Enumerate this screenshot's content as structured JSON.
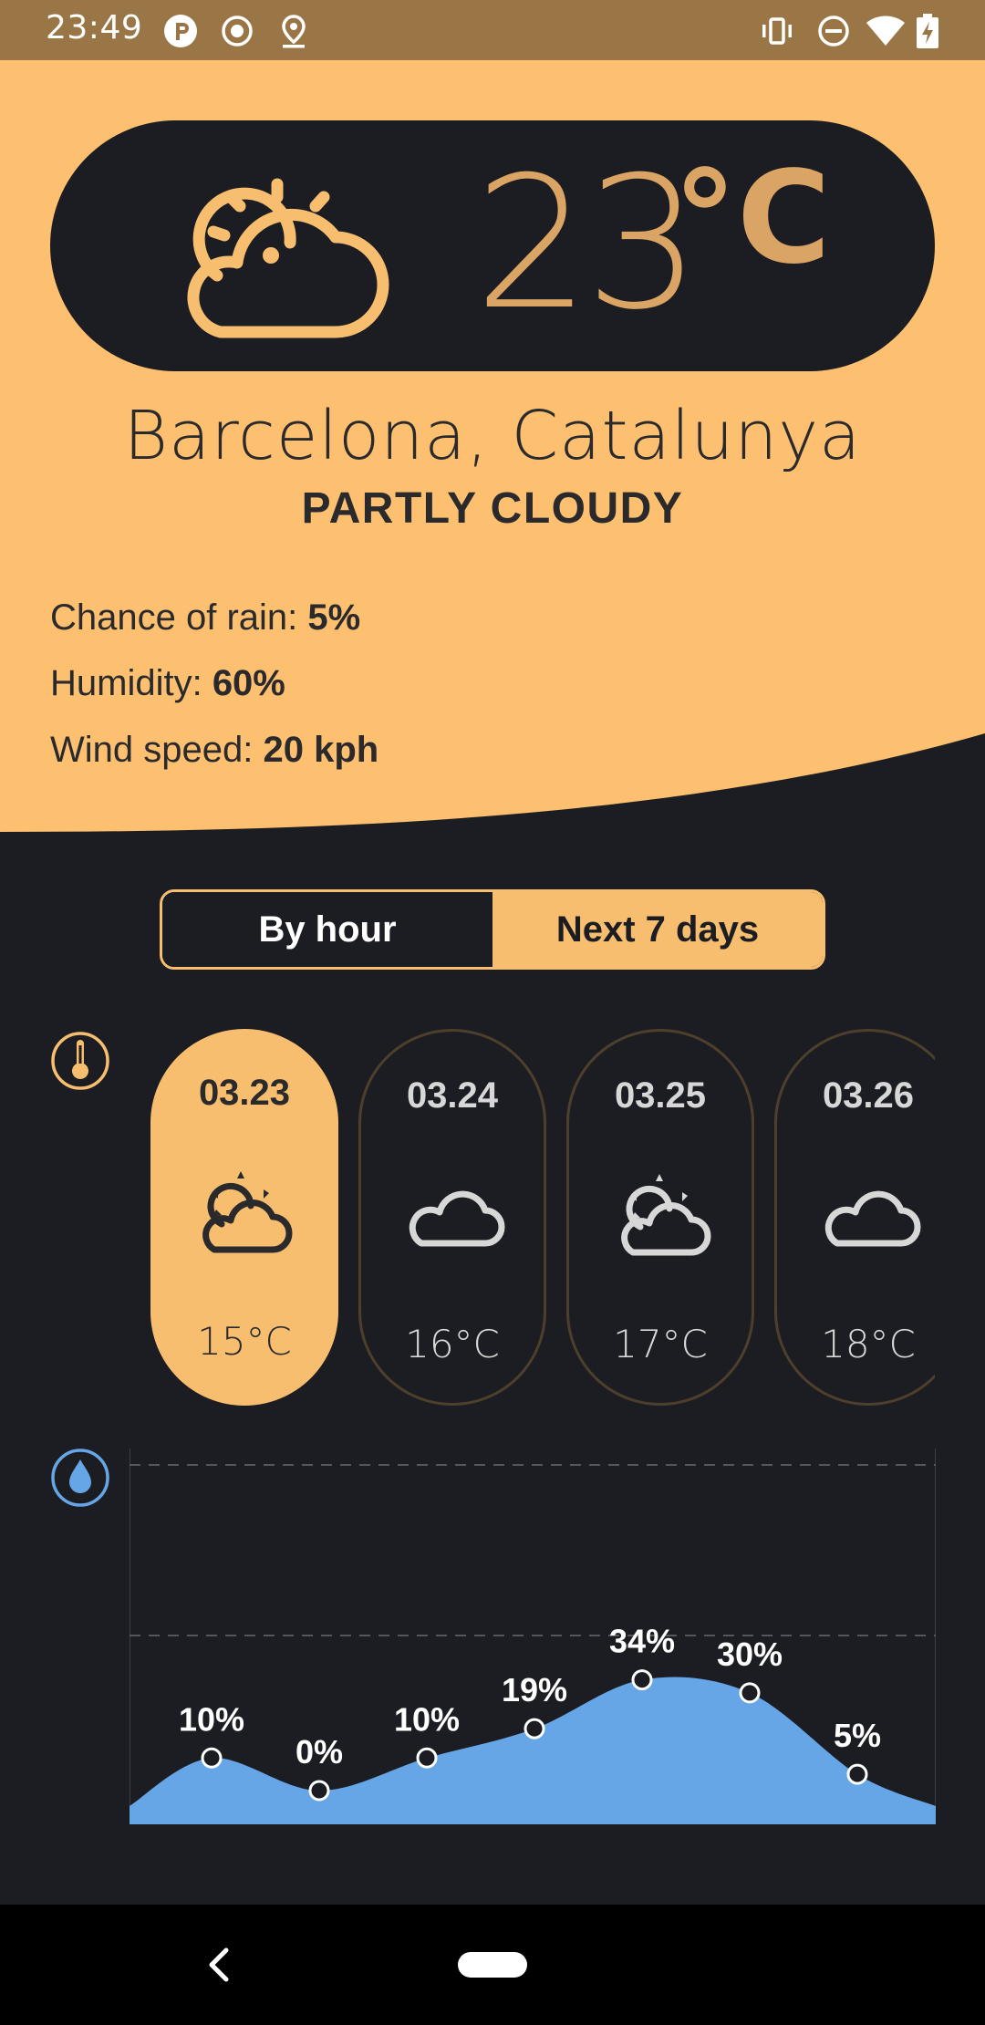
{
  "status_bar": {
    "time": "23:49",
    "left_icons": [
      "p-badge-icon",
      "screen-record-icon",
      "location-pin-icon"
    ],
    "right_icons": [
      "vibrate-icon",
      "do-not-disturb-icon",
      "wifi-icon",
      "battery-charging-icon"
    ]
  },
  "current": {
    "temperature": "23",
    "unit": "°C",
    "icon": "partly-cloudy-icon",
    "location": "Barcelona, Catalunya",
    "condition": "PARTLY CLOUDY",
    "details": [
      {
        "label": "Chance of rain: ",
        "value": "5%"
      },
      {
        "label": "Humidity: ",
        "value": "60%"
      },
      {
        "label": "Wind speed: ",
        "value": "20 kph"
      }
    ]
  },
  "toggle": {
    "by_hour": "By hour",
    "next_7_days": "Next 7 days"
  },
  "side_icons": [
    "thermometer-icon",
    "water-drop-icon"
  ],
  "days": [
    {
      "date": "03.23",
      "icon": "partly-cloudy-icon",
      "temp": "15°C",
      "selected": true
    },
    {
      "date": "03.24",
      "icon": "cloud-icon",
      "temp": "16°C",
      "selected": false
    },
    {
      "date": "03.25",
      "icon": "partly-cloudy-icon",
      "temp": "17°C",
      "selected": false
    },
    {
      "date": "03.26",
      "icon": "cloud-icon",
      "temp": "18°C",
      "selected": false
    }
  ],
  "colors": {
    "accent": "#f8be6f",
    "dark": "#1b1d22",
    "temp_text": "#d9a464",
    "rain_blue": "#66a6e6",
    "status_bar": "#9a7646"
  },
  "chart_data": {
    "type": "area",
    "values": [
      10,
      0,
      10,
      19,
      34,
      30,
      5
    ],
    "labels": [
      "10%",
      "0%",
      "10%",
      "19%",
      "34%",
      "30%",
      "5%"
    ],
    "ylim": [
      0,
      100
    ],
    "grid": true
  }
}
